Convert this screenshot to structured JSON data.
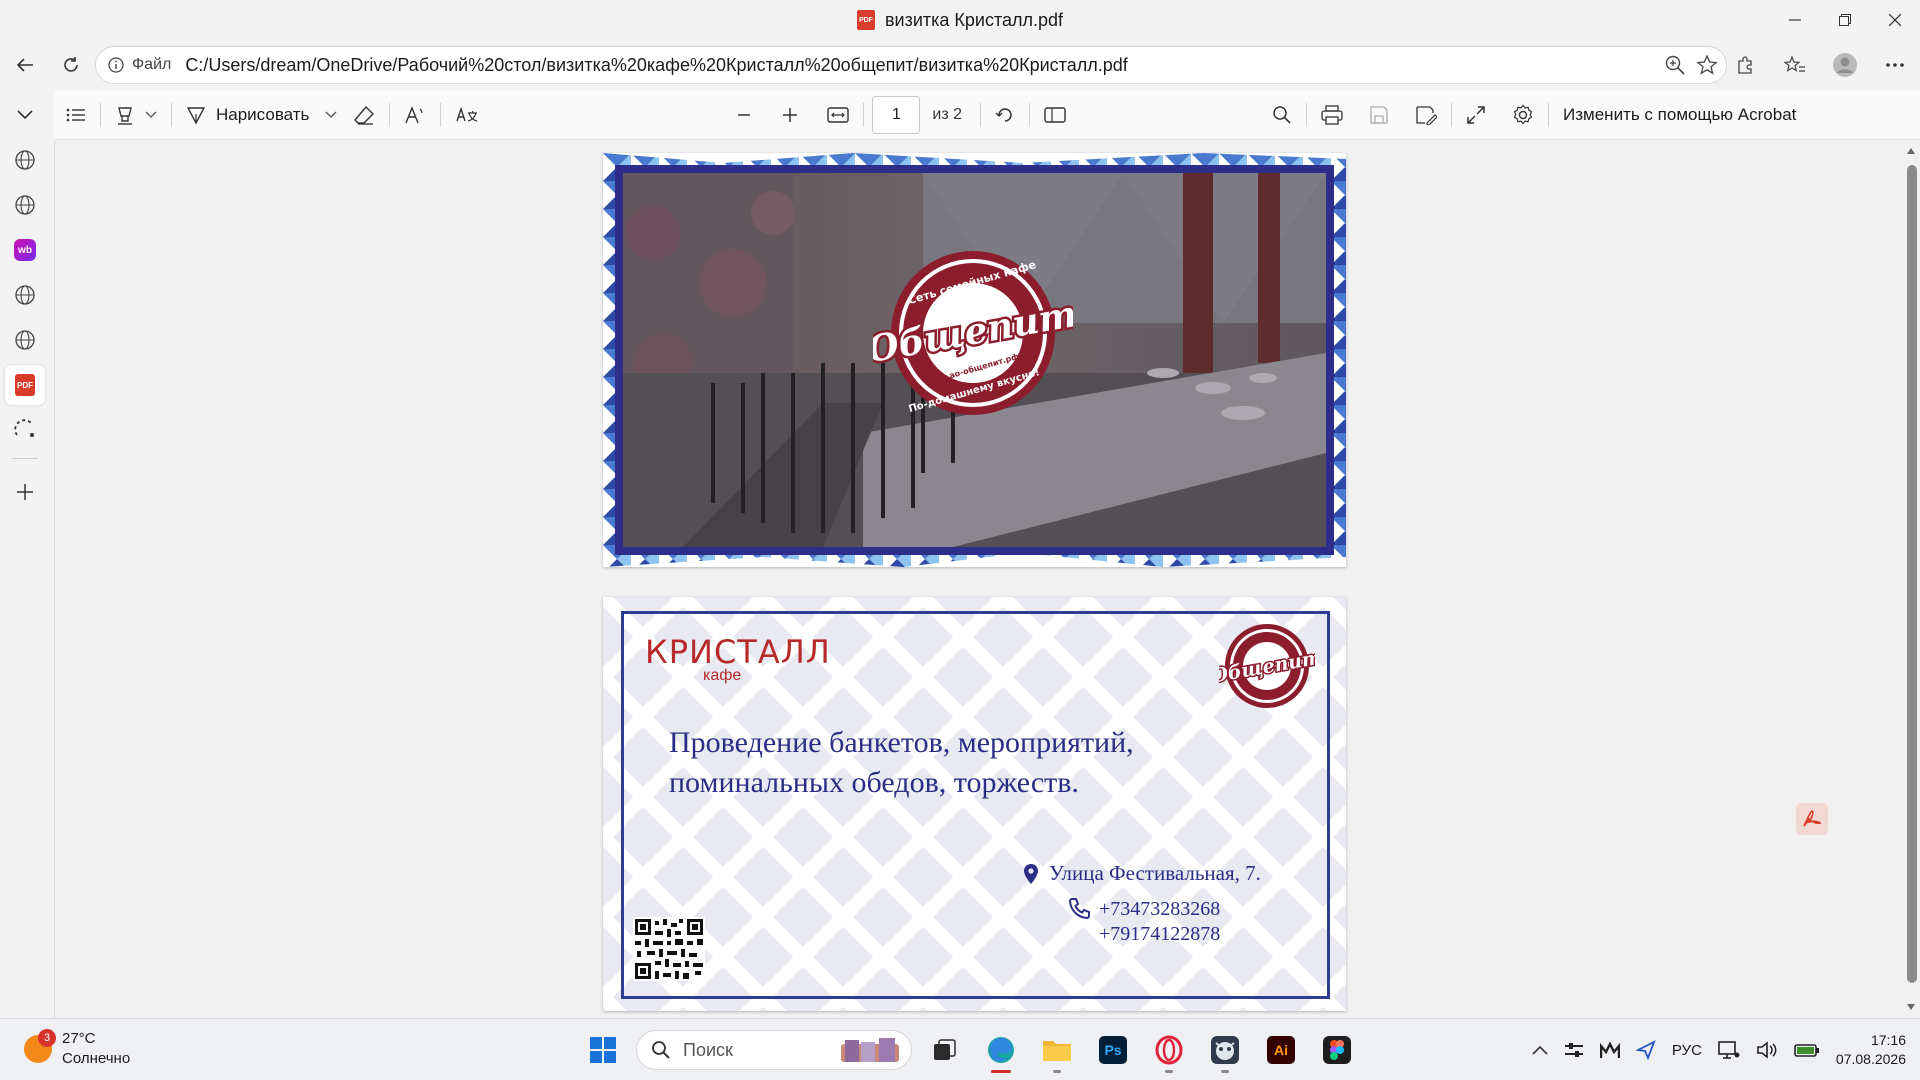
{
  "window": {
    "title": "визитка Кристалл.pdf",
    "file_badge": "PDF"
  },
  "address_bar": {
    "scheme_label": "Файл",
    "url": "C:/Users/dream/OneDrive/Рабочий%20стол/визитка%20кафе%20Кристалл%20общепит/визитка%20Кристалл.pdf"
  },
  "sidebar": {
    "items": [
      "globe-icon",
      "globe-icon",
      "wb-icon",
      "globe-icon",
      "globe-icon",
      "pdf-icon",
      "copilot-icon",
      "add-icon"
    ],
    "wb_label": "wb",
    "pdf_label": "PDF"
  },
  "pdf_toolbar": {
    "draw_label": "Нарисовать",
    "page_current": "1",
    "page_total": "из 2",
    "acrobat_label": "Изменить с помощью Acrobat"
  },
  "pdf": {
    "page1": {
      "logo_top": "Сеть семейных кафе",
      "logo_main": "Общепит",
      "logo_site": "www.ao-общепит.рф",
      "logo_bottom": "По-домашнему вкусно!"
    },
    "page2": {
      "brand_name": "КРИСТАЛЛ",
      "brand_sub": "кафе",
      "logo_main": "Общепит",
      "headline_line1": "Проведение банкетов, мероприятий,",
      "headline_line2": "поминальных обедов, торжеств.",
      "address": "Улица Фестивальная, 7.",
      "phone1": "+73473283268",
      "phone2": "+79174122878"
    }
  },
  "taskbar": {
    "weather_temp": "27°C",
    "weather_desc": "Солнечно",
    "weather_badge": "3",
    "search_placeholder": "Поиск",
    "photoshop_label": "Ps",
    "illustrator_label": "Ai",
    "language": "РУС",
    "time": "17:16",
    "date": "07.08.2026"
  },
  "colors": {
    "brand_red": "#b72a2a",
    "navy": "#2e2d8a",
    "logo_maroon": "#8c1d2c"
  }
}
